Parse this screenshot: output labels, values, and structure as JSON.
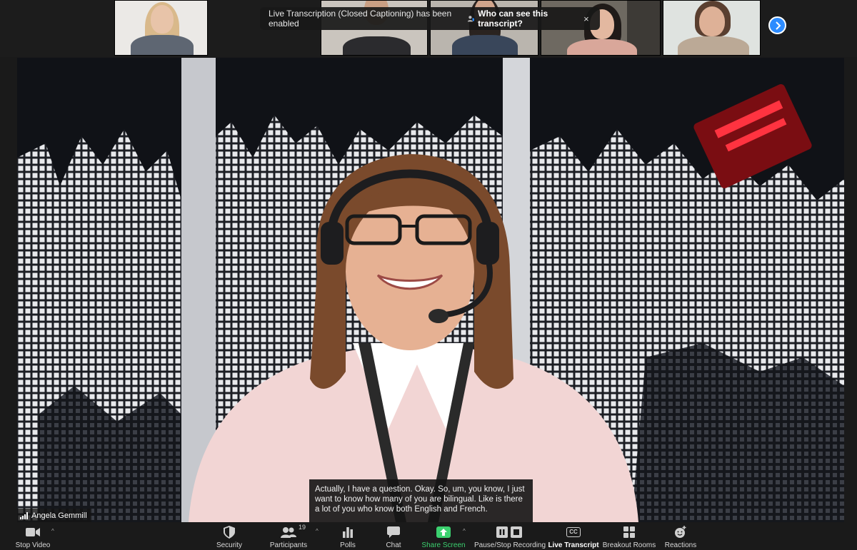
{
  "toast": {
    "message": "Live Transcription (Closed Captioning) has been enabled",
    "who_link": "Who can see this transcript?",
    "close_glyph": "×"
  },
  "gallery": {
    "participants": [
      {
        "id": "p1",
        "bg": "#e9e7e4",
        "skin": "#e8c3a8",
        "hair": "#d8b88a",
        "shirt": "#5c6470"
      },
      {
        "id": "p2",
        "bg": "#c9c4bd",
        "skin": "#c99f83",
        "hair": "#2a2522",
        "shirt": "#2b2b2e"
      },
      {
        "id": "p3",
        "bg": "#b9b4ad",
        "skin": "#d1a58c",
        "hair": "#2a2320",
        "shirt": "#39465a"
      },
      {
        "id": "p4",
        "bg": "#6f6a62",
        "skin": "#e3b8a0",
        "hair": "#1f1a18",
        "shirt": "#d9a79a"
      },
      {
        "id": "p5",
        "bg": "#dfe3e0",
        "skin": "#deb197",
        "hair": "#5a3f30",
        "shirt": "#bba996"
      }
    ]
  },
  "speaker": {
    "name": "Angela Gemmill",
    "caption": "Actually, I have a question. Okay. So, um, you know, I just want to know how many of you are bilingual. Like is there a lot of you who know both English and French."
  },
  "toolbar": {
    "stop_video": "Stop Video",
    "security": "Security",
    "participants": "Participants",
    "participants_count": "19",
    "polls": "Polls",
    "chat": "Chat",
    "share_screen": "Share Screen",
    "pause_recording": "Pause/Stop Recording",
    "live_transcript": "Live Transcript",
    "cc_badge": "CC",
    "breakout_rooms": "Breakout Rooms",
    "reactions": "Reactions",
    "caret": "^"
  },
  "colors": {
    "zoom_blue": "#2d8cff",
    "share_green": "#3bd16f",
    "toolbar_bg": "#1a1a1a"
  }
}
